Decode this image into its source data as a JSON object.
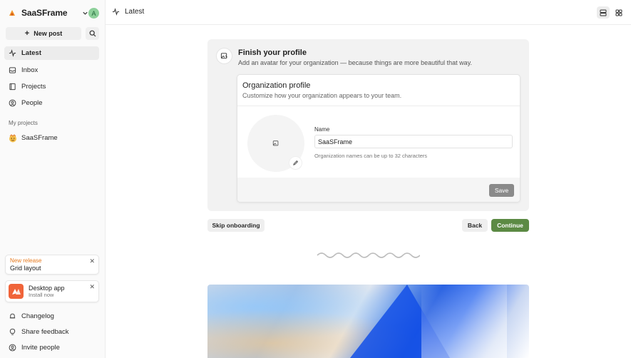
{
  "sidebar": {
    "workspace_name": "SaaSFrame",
    "avatar_initial": "A",
    "new_post_label": "New post",
    "nav": [
      {
        "label": "Latest",
        "icon": "activity-icon",
        "active": true
      },
      {
        "label": "Inbox",
        "icon": "inbox-icon"
      },
      {
        "label": "Projects",
        "icon": "book-icon"
      },
      {
        "label": "People",
        "icon": "person-circle-icon"
      }
    ],
    "projects_heading": "My projects",
    "project_name": "SaaSFrame",
    "release_card": {
      "tag": "New release",
      "title": "Grid layout"
    },
    "app_card": {
      "title": "Desktop app",
      "subtitle": "Install now"
    },
    "bottom": [
      {
        "label": "Changelog",
        "icon": "bell-icon"
      },
      {
        "label": "Share feedback",
        "icon": "bulb-icon"
      },
      {
        "label": "Invite people",
        "icon": "user-circle-icon"
      }
    ]
  },
  "topbar": {
    "title": "Latest"
  },
  "onboarding": {
    "title": "Finish your profile",
    "subtitle": "Add an avatar for your organization — because things are more beautiful that way.",
    "card": {
      "title": "Organization profile",
      "subtitle": "Customize how your organization appears to your team.",
      "name_label": "Name",
      "name_value": "SaaSFrame",
      "help": "Organization names can be up to 32 characters",
      "save_label": "Save"
    },
    "skip_label": "Skip onboarding",
    "back_label": "Back",
    "continue_label": "Continue"
  },
  "colors": {
    "accent": "#5c8a44",
    "release": "#e67a1f",
    "app_icon": "#f0643a"
  }
}
